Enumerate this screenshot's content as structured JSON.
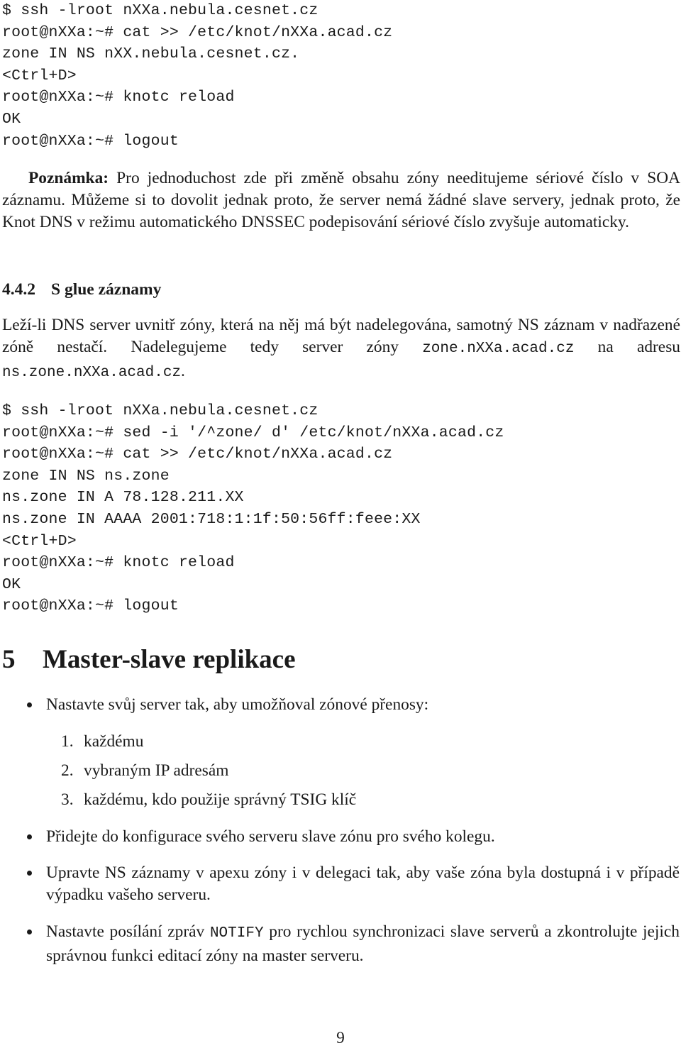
{
  "code_block_1": [
    "$ ssh -lroot nXXa.nebula.cesnet.cz",
    "root@nXXa:~# cat >> /etc/knot/nXXa.acad.cz",
    "zone IN NS nXX.nebula.cesnet.cz.",
    "<Ctrl+D>",
    "root@nXXa:~# knotc reload",
    "OK",
    "root@nXXa:~# logout"
  ],
  "note": {
    "label": "Poznámka:",
    "text": " Pro jednoduchost zde při změně obsahu zóny needitujeme sériové číslo v SOA záznamu. Můžeme si to dovolit jednak proto, že server nemá žádné slave servery, jednak proto, že Knot DNS v režimu automatického DNSSEC podepisování sériové číslo zvyšuje automaticky."
  },
  "subsection": {
    "number": "4.4.2",
    "title": "S glue záznamy"
  },
  "glue_paragraph": {
    "text_before": "Leží-li DNS server uvnitř zóny, která na něj má být nadelegována, samotný NS záznam v nadřazené zóně nestačí. Nadelegujeme tedy server zóny ",
    "code_1": "zone.nXXa.acad.cz",
    "text_middle": " na adresu ",
    "code_2": "ns.zone.nXXa.acad.cz",
    "text_after": "."
  },
  "code_block_2": [
    "$ ssh -lroot nXXa.nebula.cesnet.cz",
    "root@nXXa:~# sed -i '/^zone/ d' /etc/knot/nXXa.acad.cz",
    "root@nXXa:~# cat >> /etc/knot/nXXa.acad.cz",
    "zone IN NS ns.zone",
    "ns.zone IN A 78.128.211.XX",
    "ns.zone IN AAAA 2001:718:1:1f:50:56ff:feee:XX",
    "<Ctrl+D>",
    "root@nXXa:~# knotc reload",
    "OK",
    "root@nXXa:~# logout"
  ],
  "section": {
    "number": "5",
    "title": "Master-slave replikace"
  },
  "bullets": [
    {
      "text": "Nastavte svůj server tak, aby umožňoval zónové přenosy:"
    },
    {
      "text": "Přidejte do konfigurace svého serveru slave zónu pro svého kolegu."
    },
    {
      "text": "Upravte NS záznamy v apexu zóny i v delegaci tak, aby vaše zóna byla dostupná i v případě výpadku vašeho serveru."
    },
    {
      "text_before": "Nastavte posílání zpráv ",
      "code": "NOTIFY",
      "text_after": " pro rychlou synchronizaci slave serverů a zkontrolujte jejich správnou funkci editací zóny na master serveru."
    }
  ],
  "enumeration": [
    {
      "num": "1.",
      "text": "každému"
    },
    {
      "num": "2.",
      "text": "vybraným IP adresám"
    },
    {
      "num": "3.",
      "text": "každému, kdo použije správný TSIG klíč"
    }
  ],
  "page_number": "9"
}
